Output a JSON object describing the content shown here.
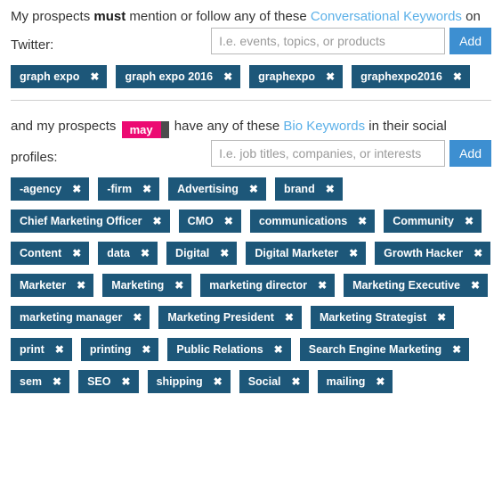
{
  "conversational": {
    "prompt_prefix": "My prospects ",
    "prompt_strong": "must",
    "prompt_mid": " mention or follow any of these ",
    "link_text": "Conversational Keywords",
    "prompt_suffix": " on",
    "label": "Twitter:",
    "input_value": "",
    "input_placeholder": "I.e. events, topics, or products",
    "add_label": "Add",
    "remove_icon": "✖",
    "tags": [
      "graph expo",
      "graph expo 2016",
      "graphexpo",
      "graphexpo2016"
    ]
  },
  "bio": {
    "prompt_prefix": "and my prospects ",
    "toggle_value": "may",
    "prompt_mid": " have any of these ",
    "link_text": "Bio Keywords",
    "prompt_suffix": " in their social",
    "label": "profiles:",
    "input_value": "",
    "input_placeholder": "I.e. job titles, companies, or interests",
    "add_label": "Add",
    "remove_icon": "✖",
    "tags": [
      "-agency",
      "-firm",
      "Advertising",
      "brand",
      "Chief Marketing Officer",
      "CMO",
      "communications",
      "Community",
      "Content",
      "data",
      "Digital",
      "Digital Marketer",
      "Growth Hacker",
      "Marketer",
      "Marketing",
      "marketing director",
      "Marketing Executive",
      "marketing manager",
      "Marketing President",
      "Marketing Strategist",
      "print",
      "printing",
      "Public Relations",
      "Search Engine Marketing",
      "sem",
      "SEO",
      "shipping",
      "Social",
      "mailing"
    ]
  },
  "colors": {
    "tag_bg": "#1d5779",
    "add_btn": "#3d8fd1",
    "link": "#5bb0e8",
    "toggle_on": "#ec0a72",
    "toggle_track": "#4c4c4c"
  }
}
